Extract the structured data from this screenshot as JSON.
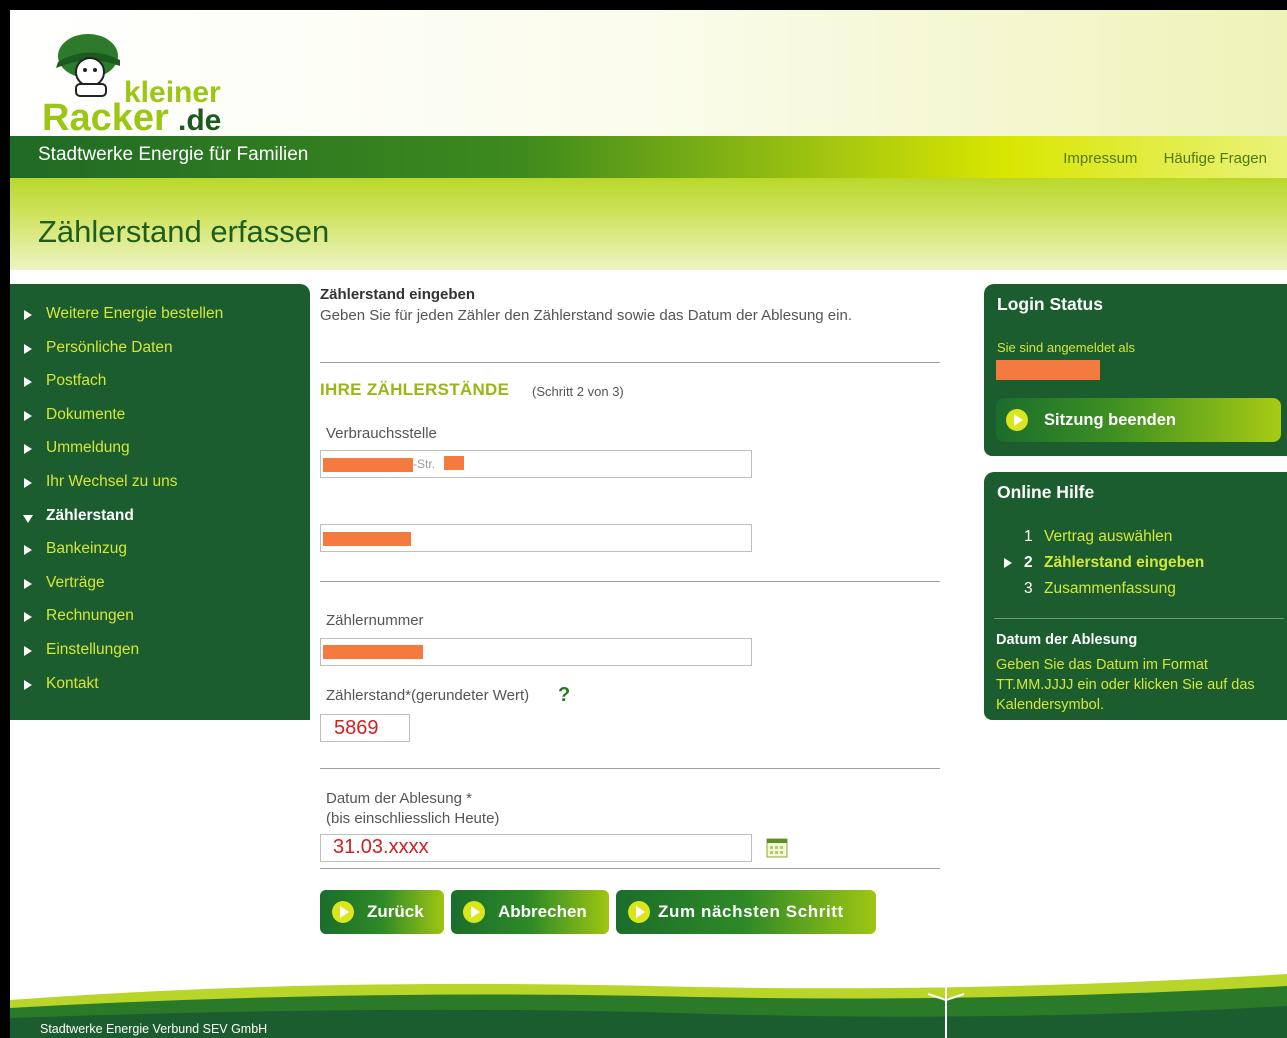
{
  "brand": {
    "logo_text_top": "kleiner",
    "logo_text_bottom": "Racker.de",
    "tagline": "Stadtwerke Energie für Familien"
  },
  "top_links": [
    "Impressum",
    "Häufige Fragen"
  ],
  "page_title": "Zählerstand erfassen",
  "nav": [
    {
      "label": "Weitere Energie bestellen"
    },
    {
      "label": "Persönliche Daten"
    },
    {
      "label": "Postfach"
    },
    {
      "label": "Dokumente"
    },
    {
      "label": "Ummeldung"
    },
    {
      "label": "Ihr Wechsel zu uns"
    },
    {
      "label": "Zählerstand",
      "active": true
    },
    {
      "label": "Bankeinzug"
    },
    {
      "label": "Verträge"
    },
    {
      "label": "Rechnungen"
    },
    {
      "label": "Einstellungen"
    },
    {
      "label": "Kontakt"
    }
  ],
  "main": {
    "heading": "Zählerstand eingeben",
    "intro": "Geben Sie für jeden Zähler den Zählerstand sowie das Datum der Ablesung ein.",
    "section_title": "IHRE ZÄHLERSTÄNDE",
    "step_note": "(Schritt 2 von 3)",
    "verbrauchsstelle_label": "Verbrauchsstelle",
    "street_suffix": "-Str.",
    "zaehlernummer_label": "Zählernummer",
    "zaehlerstand_label": "Zählerstand*(gerundeter Wert)",
    "help_q": "?",
    "zaehlerstand_value": "5869",
    "datum_label_1": "Datum der Ablesung *",
    "datum_label_2": "(bis einschliesslich Heute)",
    "datum_value": "31.03.xxxx",
    "buttons": {
      "back": "Zurück",
      "cancel": "Abbrechen",
      "next": "Zum nächsten Schritt"
    }
  },
  "login": {
    "title": "Login Status",
    "text": "Sie sind angemeldet als",
    "logout": "Sitzung beenden"
  },
  "help": {
    "title": "Online Hilfe",
    "steps": [
      {
        "n": "1",
        "label": "Vertrag auswählen"
      },
      {
        "n": "2",
        "label": "Zählerstand eingeben",
        "active": true
      },
      {
        "n": "3",
        "label": "Zusammenfassung"
      }
    ],
    "sub_title": "Datum der Ablesung",
    "body": "Geben Sie das Datum im Format TT.MM.JJJJ ein oder klicken Sie auf das Kalendersymbol."
  },
  "footer": {
    "text": "Stadtwerke Energie Verbund SEV GmbH"
  },
  "colors": {
    "dark_green": "#1b5d2e",
    "lime": "#d5e63a",
    "accent_red": "#d02020",
    "redaction": "#f47a3f"
  }
}
